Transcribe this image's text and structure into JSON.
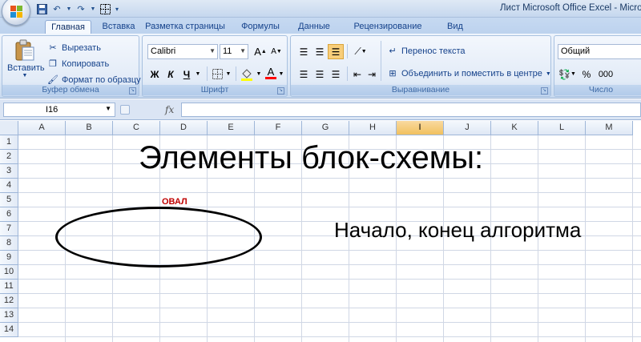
{
  "window": {
    "title": "Лист Microsoft Office Excel - Micro"
  },
  "tabs": [
    "Главная",
    "Вставка",
    "Разметка страницы",
    "Формулы",
    "Данные",
    "Рецензирование",
    "Вид"
  ],
  "clipboard": {
    "paste": "Вставить",
    "cut": "Вырезать",
    "copy": "Копировать",
    "format_painter": "Формат по образцу",
    "group_label": "Буфер обмена"
  },
  "font": {
    "name": "Calibri",
    "size": "11",
    "grow_label": "A",
    "shrink_label": "A",
    "bold": "Ж",
    "italic": "К",
    "underline": "Ч",
    "color_label": "A",
    "group_label": "Шрифт"
  },
  "alignment": {
    "wrap_text": "Перенос текста",
    "merge_center": "Объединить и поместить в центре",
    "group_label": "Выравнивание"
  },
  "number": {
    "format": "Общий",
    "percent": "%",
    "thousands": "000",
    "group_label": "Число"
  },
  "formula_bar": {
    "name_box": "I16",
    "fx": "fx",
    "formula": ""
  },
  "columns": [
    "A",
    "B",
    "C",
    "D",
    "E",
    "F",
    "G",
    "H",
    "I",
    "J",
    "K",
    "L",
    "M"
  ],
  "selected_column": "I",
  "rows": [
    "1",
    "2",
    "3",
    "4",
    "5",
    "6",
    "7",
    "8",
    "9",
    "10",
    "11",
    "12",
    "13",
    "14"
  ],
  "sheet": {
    "title": "Элементы блок-схемы:",
    "oval_label": "ОВАЛ",
    "description": "Начало, конец алгоритма"
  },
  "colors": {
    "accent": "#c00000",
    "selected_header": "#f1c15f",
    "ribbon": "#dde8f6"
  }
}
